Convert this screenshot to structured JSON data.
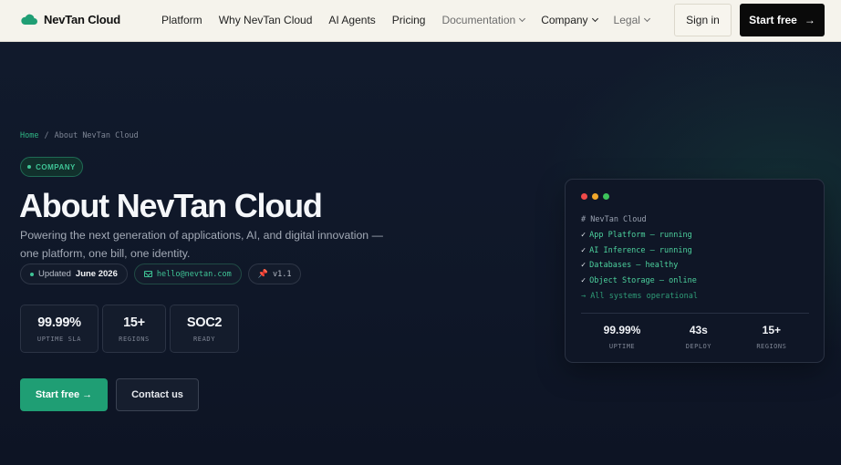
{
  "nav": {
    "brand": "NevTan Cloud",
    "links": [
      {
        "label": "Platform"
      },
      {
        "label": "Why NevTan Cloud"
      },
      {
        "label": "AI Agents"
      },
      {
        "label": "Pricing"
      },
      {
        "label": "Documentation"
      },
      {
        "label": "Company"
      },
      {
        "label": "Legal"
      }
    ],
    "signin": "Sign in",
    "start": "Start free",
    "start_arrow": "→"
  },
  "hero": {
    "breadcrumb": {
      "home": "Home",
      "sep": "/",
      "current": "About NevTan Cloud"
    },
    "badge": "COMPANY",
    "title": "About NevTan Cloud",
    "subtitle": "Powering the next generation of applications, AI, and digital innovation — one platform, one bill, one identity.",
    "meta": {
      "updated_prefix": "Updated",
      "updated_value": "June 2026",
      "email": "hello@nevtan.com",
      "version": "v1.1"
    },
    "stats": [
      {
        "value": "99.99%",
        "label": "UPTIME SLA"
      },
      {
        "value": "15+",
        "label": "REGIONS"
      },
      {
        "value": "SOC2",
        "label": "READY"
      }
    ],
    "cta_primary": "Start free →",
    "cta_secondary": "Contact us"
  },
  "terminal": {
    "dots": [
      "#ef4a49",
      "#f1a72b",
      "#3dc45b"
    ],
    "header": "# NevTan Cloud",
    "lines": [
      {
        "tick": "✓",
        "text": "App Platform — running"
      },
      {
        "tick": "✓",
        "text": "AI Inference — running"
      },
      {
        "tick": "✓",
        "text": "Databases — healthy"
      },
      {
        "tick": "✓",
        "text": "Object Storage — online"
      }
    ],
    "status": "→ All systems operational",
    "stats": [
      {
        "value": "99.99%",
        "label": "UPTIME"
      },
      {
        "value": "43s",
        "label": "DEPLOY"
      },
      {
        "value": "15+",
        "label": "REGIONS"
      }
    ]
  },
  "colors": {
    "accent": "#1f9e74",
    "accent_text": "#3fc496",
    "nav_bg": "#f5f3ec",
    "hero_bg": "#0f1728"
  }
}
